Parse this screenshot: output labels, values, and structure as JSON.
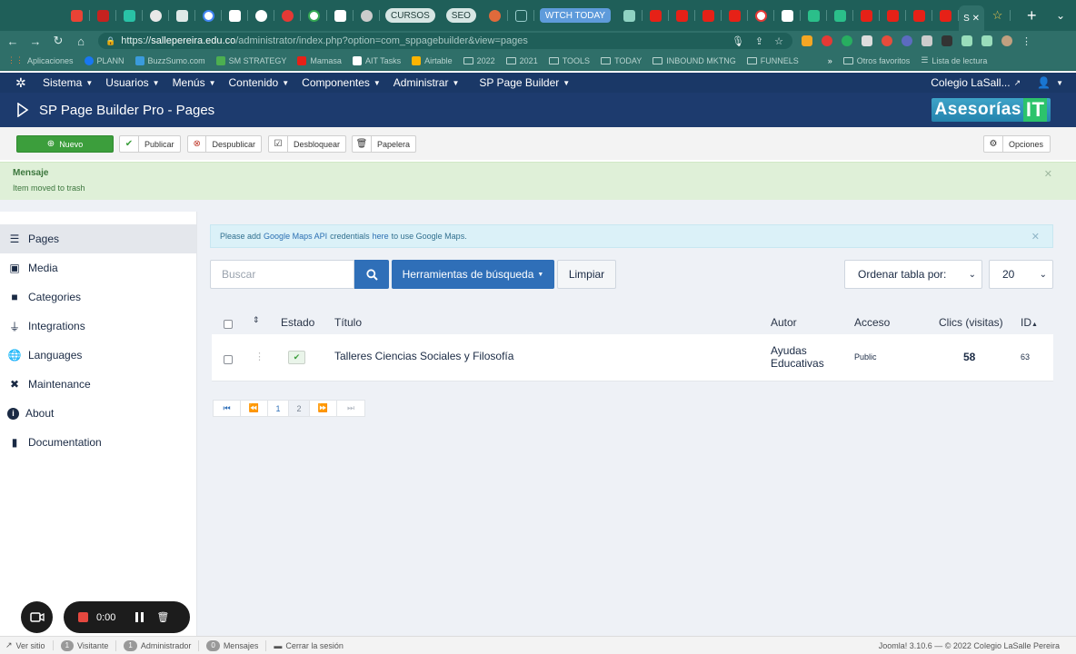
{
  "browser": {
    "tabs_pills": [
      "CURSOS",
      "SEO",
      "WTCH TODAY"
    ],
    "active_tab_label": "S",
    "url_host": "sallepereira.edu.co",
    "url_prefix": "https://",
    "url_path": "/administrator/index.php?option=com_sppagebuilder&view=pages",
    "bookmarks": [
      "Aplicaciones",
      "PLANN",
      "BuzzSumo.com",
      "SM STRATEGY",
      "Mamasa",
      "AIT Tasks",
      "Airtable",
      "2022",
      "2021",
      "TOOLS",
      "TODAY",
      "INBOUND MKTNG",
      "FUNNELS"
    ],
    "bookmarks_right": [
      "Otros favoritos",
      "Lista de lectura"
    ]
  },
  "adminbar": {
    "menus": [
      "Sistema",
      "Usuarios",
      "Menús",
      "Contenido",
      "Componentes",
      "Administrar",
      "SP Page Builder"
    ],
    "site_link": "Colegio LaSall..."
  },
  "header": {
    "title": "SP Page Builder Pro - Pages",
    "brand_text": "Asesorías",
    "brand_suffix": "IT"
  },
  "toolbar": {
    "new": "Nuevo",
    "publish": "Publicar",
    "unpublish": "Despublicar",
    "unlock": "Desbloquear",
    "trash": "Papelera",
    "options": "Opciones"
  },
  "message": {
    "heading": "Mensaje",
    "text": "Item moved to trash"
  },
  "sidebar": {
    "items": [
      {
        "label": "Pages",
        "icon": "list-icon"
      },
      {
        "label": "Media",
        "icon": "image-icon"
      },
      {
        "label": "Categories",
        "icon": "folder-icon"
      },
      {
        "label": "Integrations",
        "icon": "plug-icon"
      },
      {
        "label": "Languages",
        "icon": "globe-icon"
      },
      {
        "label": "Maintenance",
        "icon": "tools-icon"
      },
      {
        "label": "About",
        "icon": "info-icon"
      },
      {
        "label": "Documentation",
        "icon": "book-icon"
      }
    ]
  },
  "notice": {
    "before": "Please add",
    "link1": "Google Maps API",
    "middle": "credentials",
    "link2": "here",
    "after": "to use Google Maps."
  },
  "filters": {
    "search_placeholder": "Buscar",
    "tools": "Herramientas de búsqueda",
    "clear": "Limpiar",
    "order_by": "Ordenar tabla por:",
    "limit": "20"
  },
  "table": {
    "headers": {
      "status": "Estado",
      "title": "Título",
      "author": "Autor",
      "access": "Acceso",
      "hits": "Clics (visitas)",
      "id": "ID"
    },
    "rows": [
      {
        "title": "Talleres Ciencias Sociales y Filosofía",
        "author_line1": "Ayudas",
        "author_line2": "Educativas",
        "access": "Public",
        "hits": "58",
        "id": "63"
      }
    ]
  },
  "pagination": {
    "pages": [
      "1",
      "2"
    ]
  },
  "recorder": {
    "time": "0:00"
  },
  "footer": {
    "view_site": "Ver sitio",
    "visitors_count": "1",
    "visitors": "Visitante",
    "admins_count": "1",
    "admins": "Administrador",
    "messages_count": "0",
    "messages": "Mensajes",
    "logout": "Cerrar la sesión",
    "version": "Joomla! 3.10.6",
    "copyright": "© 2022 Colegio LaSalle Pereira"
  },
  "colors": {
    "admin_navy": "#1a3867",
    "primary_blue": "#2f6fb8",
    "new_green": "#3c9e3c",
    "success_bg": "#dff0d8",
    "browser_teal": "#1f5f59"
  }
}
